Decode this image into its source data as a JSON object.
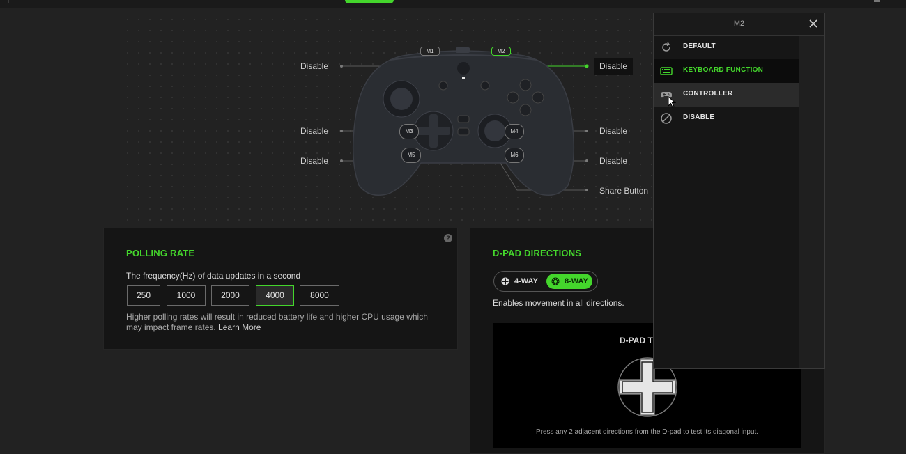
{
  "controller": {
    "buttons": [
      "M1",
      "M2",
      "M3",
      "M4",
      "M5",
      "M6"
    ],
    "mappings": [
      {
        "side": "left",
        "value": "Disable"
      },
      {
        "side": "right",
        "value": "Disable"
      },
      {
        "side": "left",
        "value": "Disable"
      },
      {
        "side": "right",
        "value": "Disable"
      },
      {
        "side": "left",
        "value": "Disable"
      },
      {
        "side": "right",
        "value": "Disable"
      },
      {
        "side": "right",
        "value": "Share Button"
      }
    ]
  },
  "polling": {
    "title": "POLLING RATE",
    "help": "?",
    "description": "The frequency(Hz) of data updates in a second",
    "options": [
      "250",
      "1000",
      "2000",
      "4000",
      "8000"
    ],
    "selected": "4000",
    "note": "Higher polling rates will result in reduced battery life and higher CPU usage which may impact frame rates.",
    "learn_more": "Learn More"
  },
  "dpad": {
    "title": "D-PAD DIRECTIONS",
    "options": [
      "4-WAY",
      "8-WAY"
    ],
    "selected": "8-WAY",
    "description": "Enables movement in all directions.",
    "test_title": "D-PAD TE",
    "test_hint": "Press any 2 adjacent directions from the D-pad to test its diagonal input."
  },
  "dropdown": {
    "title": "M2",
    "items": [
      {
        "label": "DEFAULT",
        "icon": "refresh-icon"
      },
      {
        "label": "KEYBOARD FUNCTION",
        "icon": "keyboard-icon"
      },
      {
        "label": "CONTROLLER",
        "icon": "gamepad-icon"
      },
      {
        "label": "DISABLE",
        "icon": "disable-icon"
      }
    ],
    "selected": "KEYBOARD FUNCTION",
    "hovered": "CONTROLLER"
  },
  "colors": {
    "accent": "#44d62c",
    "background": "#222222",
    "panel": "#151515"
  }
}
